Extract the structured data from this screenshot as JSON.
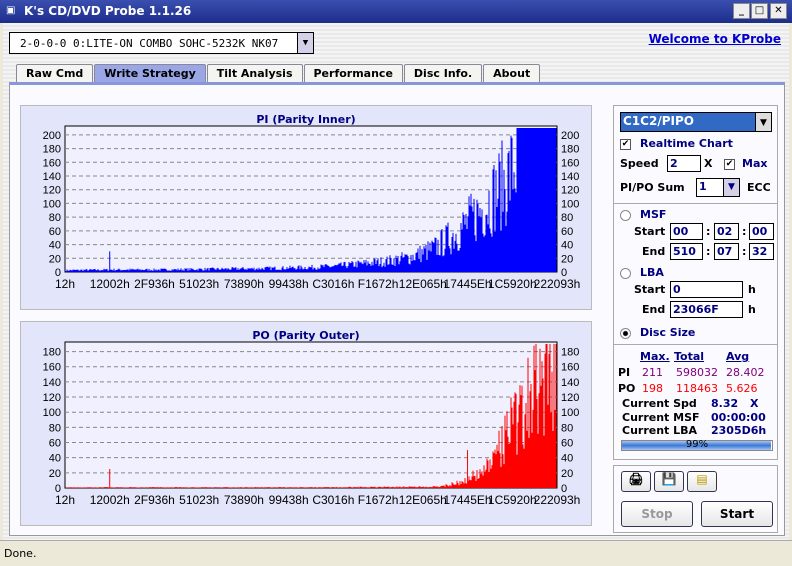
{
  "window": {
    "title": "K's CD/DVD Probe 1.1.26"
  },
  "drive": {
    "selected": "2-0-0-0 0:LITE-ON COMBO SOHC-5232K NK07"
  },
  "welcome_link": "Welcome to KProbe",
  "tabs": [
    {
      "label": "Raw Cmd"
    },
    {
      "label": "Write Strategy",
      "active": true
    },
    {
      "label": "Tilt Analysis"
    },
    {
      "label": "Performance"
    },
    {
      "label": "Disc Info."
    },
    {
      "label": "About"
    }
  ],
  "controls": {
    "mode": "C1C2/PIPO",
    "realtime_label": "Realtime Chart",
    "realtime_checked": true,
    "speed_label": "Speed",
    "speed": "2",
    "speed_unit": "X",
    "max_label": "Max",
    "max_checked": true,
    "sum_label": "PI/PO Sum",
    "sum": "1",
    "ecc_label": "ECC",
    "msf_label": "MSF",
    "start_label": "Start",
    "end_label": "End",
    "msf_start": [
      "00",
      "02",
      "00"
    ],
    "msf_end": [
      "510",
      "07",
      "32"
    ],
    "lba_label": "LBA",
    "lba_start": "0",
    "lba_end": "23066F",
    "h": "h",
    "disc_size_label": "Disc Size",
    "range_mode": "Disc Size"
  },
  "stats": {
    "headers": [
      "Max.",
      "Total",
      "Avg"
    ],
    "pi": {
      "label": "PI",
      "max": "211",
      "total": "598032",
      "avg": "28.402"
    },
    "po": {
      "label": "PO",
      "max": "198",
      "total": "118463",
      "avg": "5.626"
    },
    "spd_label": "Current Spd",
    "spd": "8.32",
    "spd_unit": "X",
    "msf_label": "Current MSF",
    "msf": "00:00:00",
    "lba_label": "Current LBA",
    "lba": "2305D6h",
    "progress": 99,
    "progress_text": "99%"
  },
  "buttons": {
    "stop": "Stop",
    "start": "Start"
  },
  "status": "Done.",
  "colors": {
    "pi": "#0000ff",
    "po": "#ff0000",
    "title_bar": "#1d2d8a"
  },
  "chart_data": [
    {
      "type": "bar",
      "title": "PI (Parity Inner)",
      "ylim": [
        0,
        210
      ],
      "yticks": [
        0,
        20,
        40,
        60,
        80,
        100,
        120,
        140,
        160,
        180,
        200
      ],
      "xticks": [
        "12h",
        "12002h",
        "2F936h",
        "51023h",
        "73890h",
        "99438h",
        "C3016h",
        "F1672h",
        "12E065h",
        "17445Eh",
        "1C5920h",
        "222093h"
      ],
      "envelope_x": [
        0,
        0.1,
        0.2,
        0.3,
        0.4,
        0.5,
        0.55,
        0.6,
        0.65,
        0.7,
        0.75,
        0.8,
        0.85,
        0.9,
        0.93,
        1
      ],
      "envelope_y": [
        3,
        4,
        4,
        5,
        6,
        8,
        10,
        14,
        18,
        25,
        40,
        70,
        110,
        160,
        205,
        210
      ],
      "spikes": [
        {
          "at": "12002h",
          "value": 30
        }
      ],
      "grid": true
    },
    {
      "type": "bar",
      "title": "PO (Parity Outer)",
      "ylim": [
        0,
        190
      ],
      "yticks": [
        0,
        20,
        40,
        60,
        80,
        100,
        120,
        140,
        160,
        180
      ],
      "xticks": [
        "12h",
        "12002h",
        "2F936h",
        "51023h",
        "73890h",
        "99438h",
        "C3016h",
        "F1672h",
        "12E065h",
        "17445Eh",
        "1C5920h",
        "222093h"
      ],
      "envelope_x": [
        0,
        0.5,
        0.76,
        0.8,
        0.85,
        0.88,
        0.92,
        0.96,
        1
      ],
      "envelope_y": [
        1,
        1,
        2,
        8,
        25,
        60,
        110,
        160,
        195
      ],
      "spikes": [
        {
          "at": "12002h",
          "value": 25
        },
        {
          "at": "17445Eh",
          "value": 50
        }
      ],
      "grid": true
    }
  ]
}
